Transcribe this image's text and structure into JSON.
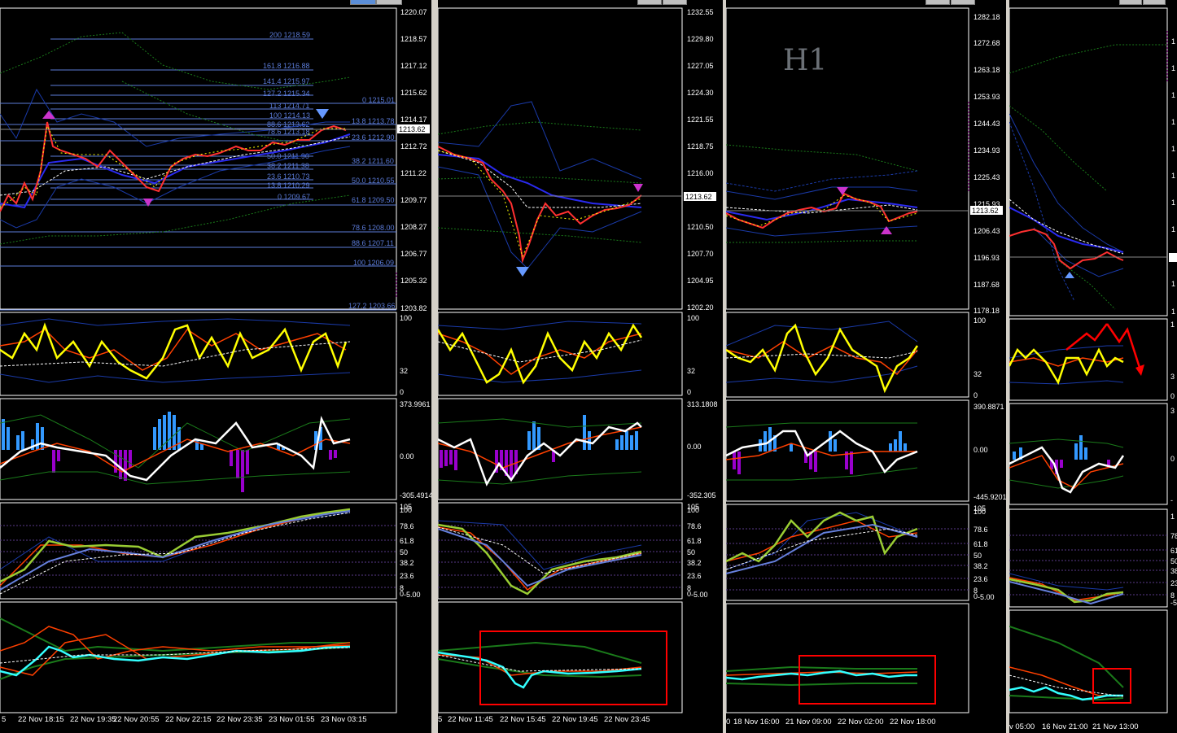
{
  "colors": {
    "background": "#000000",
    "separator": "#d4d0c8",
    "grid": "#ffffff",
    "fib": "#5b7bd8",
    "yellow": "#ffff00",
    "histo_up": "#3399ff",
    "histo_down": "#9900cc",
    "macd_white": "#ffffff",
    "cyan": "#33ffff",
    "red_box": "#ff0000"
  },
  "current_price": "1213.62",
  "win1": {
    "price_ticks": [
      "1220.07",
      "1218.57",
      "1217.12",
      "1215.62",
      "1214.17",
      "1212.72",
      "1211.22",
      "1209.77",
      "1208.27",
      "1206.77",
      "1205.32",
      "1203.82"
    ],
    "fib_labels": [
      "200 1218.59",
      "161.8 1216.88",
      "141.4 1215.97",
      "127.2 1215.34",
      "0 1215.01",
      "113 1214.71",
      "100 1214.13",
      "13.8 1213.78",
      "88.6 1213.62",
      "78.6 1213.18",
      "23.6 1212.90",
      "50.0 1211.90",
      "38.2 1211.60",
      "38.2 1211.38",
      "23.6 1210.73",
      "50.0 1210.55",
      "13.8 1210.29",
      "0 1209.67",
      "61.8 1209.50",
      "78.6 1208.00",
      "88.6 1207.11",
      "100 1206.09",
      "127.2 1203.66"
    ],
    "rsi_ticks": [
      "100",
      "32",
      "0"
    ],
    "macd_ticks": [
      "373.9961",
      "0.00",
      "-305.4914"
    ],
    "stoch_ticks": [
      "105",
      "100",
      "78.6",
      "61.8",
      "50",
      "38.2",
      "23.6",
      "8",
      "0",
      "-5.00"
    ],
    "dates": [
      "5",
      "22 Nov 18:15",
      "22 Nov 19:35",
      "22 Nov 20:55",
      "22 Nov 22:15",
      "22 Nov 23:35",
      "23 Nov 01:55",
      "23 Nov 03:15"
    ]
  },
  "win2": {
    "price_ticks": [
      "1232.55",
      "1229.80",
      "1227.05",
      "1224.30",
      "1221.55",
      "1218.75",
      "1216.00",
      "1213.62",
      "1210.50",
      "1207.70",
      "1204.95",
      "1202.20"
    ],
    "rsi_ticks": [
      "100",
      "32",
      "0"
    ],
    "macd_ticks": [
      "313.1808",
      "0.00",
      "-352.305"
    ],
    "stoch_ticks": [
      "105",
      "100",
      "78.6",
      "61.8",
      "50",
      "38.2",
      "23.6",
      "8",
      "0",
      "-5.00"
    ],
    "dates": [
      "5",
      "22 Nov 11:45",
      "22 Nov 15:45",
      "22 Nov 19:45",
      "22 Nov 23:45"
    ]
  },
  "win3": {
    "timeframe_label": "H1",
    "price_ticks": [
      "1282.18",
      "1272.68",
      "1263.18",
      "1253.93",
      "1244.43",
      "1234.93",
      "1225.43",
      "1215.93",
      "1213.62",
      "1206.43",
      "1196.93",
      "1187.68",
      "1178.18"
    ],
    "rsi_ticks": [
      "100",
      "32",
      "0"
    ],
    "macd_ticks": [
      "390.8871",
      "0.00",
      "-445.9201"
    ],
    "stoch_ticks": [
      "105",
      "100",
      "78.6",
      "61.8",
      "50",
      "38.2",
      "23.6",
      "8",
      "0",
      "-5.00"
    ],
    "dates": [
      "0",
      "18 Nov 16:00",
      "21 Nov 09:00",
      "22 Nov 02:00",
      "22 Nov 18:00"
    ]
  },
  "win4": {
    "price_ticks": [
      "1",
      "1",
      "1",
      "1",
      "1",
      "1",
      "1",
      "1",
      "1",
      "1"
    ],
    "rsi_ticks": [
      "1",
      "3",
      "0"
    ],
    "macd_ticks": [
      "3",
      "0",
      "-"
    ],
    "stoch_ticks": [
      "1",
      "78",
      "61",
      "50",
      "38",
      "23",
      "8",
      "-5"
    ],
    "dates": [
      "v 05:00",
      "16 Nov 21:00",
      "21 Nov 13:00"
    ]
  }
}
